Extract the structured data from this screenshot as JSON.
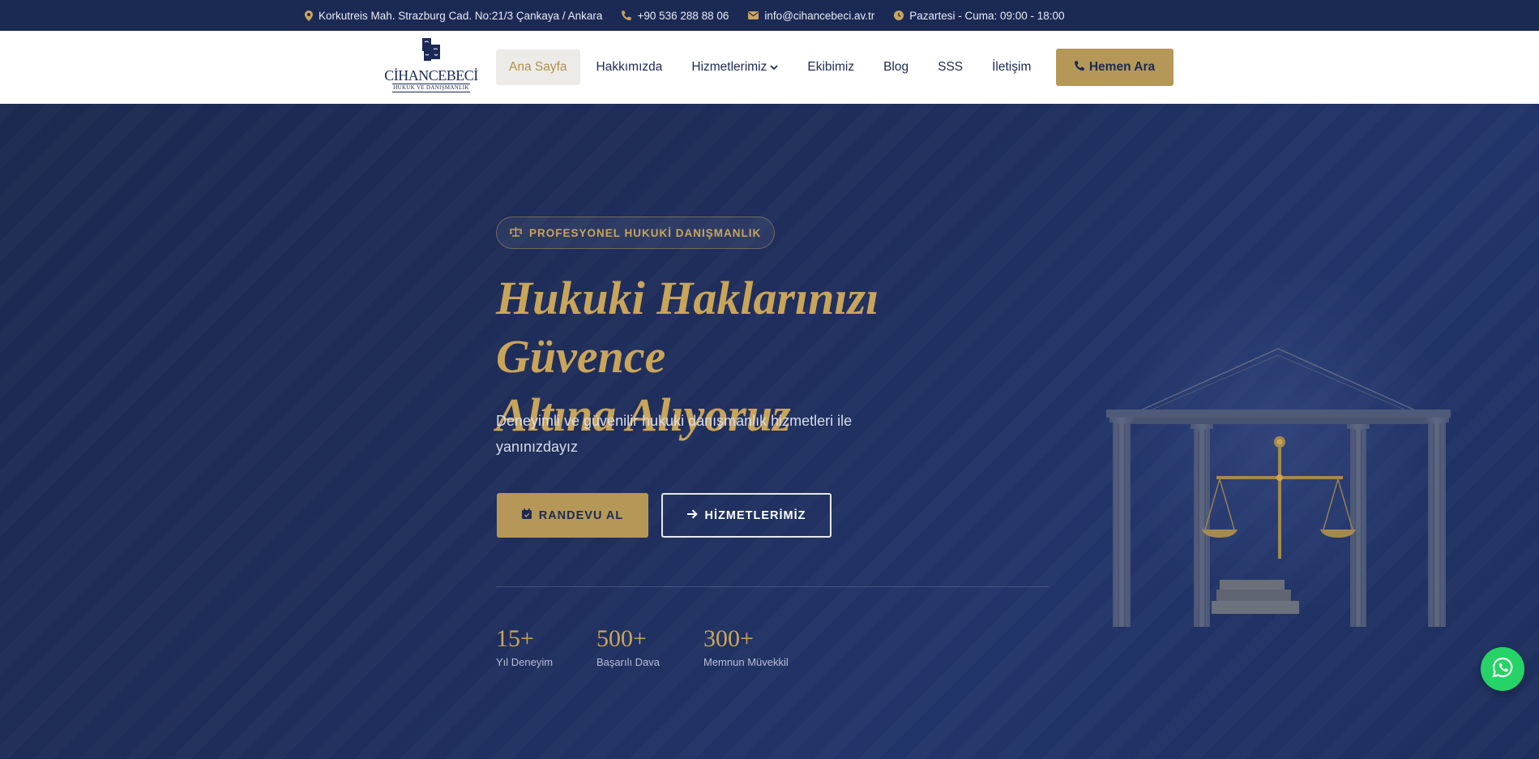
{
  "topbar": {
    "address": "Korkutreis Mah. Strazburg Cad. No:21/3 Çankaya / Ankara",
    "phone": "+90 536 288 88 06",
    "email": "info@cihancebeci.av.tr",
    "hours": "Pazartesi - Cuma: 09:00 - 18:00"
  },
  "logo": {
    "name": "CİHANCEBECİ",
    "tagline": "HUKUK VE DANIŞMANLIK"
  },
  "nav": {
    "items": [
      {
        "label": "Ana Sayfa",
        "active": true
      },
      {
        "label": "Hakkımızda"
      },
      {
        "label": "Hizmetlerimiz",
        "dropdown": true
      },
      {
        "label": "Ekibimiz"
      },
      {
        "label": "Blog"
      },
      {
        "label": "SSS"
      },
      {
        "label": "İletişim"
      }
    ],
    "call_label": "Hemen Ara"
  },
  "hero": {
    "badge": "PROFESYONEL HUKUKİ DANIŞMANLIK",
    "headline_line1": "Hukuki Haklarınızı Güvence",
    "headline_line2": "Altına Alıyoruz",
    "subtitle": "Deneyimli ve güvenilir hukuki danışmanlık hizmetleri ile yanınızdayız",
    "primary_button": "RANDEVU AL",
    "secondary_button": "HİZMETLERİMİZ",
    "stats": [
      {
        "value": "15+",
        "label": "Yıl Deneyim"
      },
      {
        "value": "500+",
        "label": "Başarılı Dava"
      },
      {
        "value": "300+",
        "label": "Memnun Müvekkil"
      }
    ]
  },
  "colors": {
    "navy": "#1b2a55",
    "gold": "#c9a55a",
    "button_gold": "#b59858",
    "whatsapp": "#25d366"
  },
  "icons": [
    "map-marker-icon",
    "phone-icon",
    "envelope-icon",
    "clock-icon",
    "chevron-down-icon",
    "scale-icon",
    "calendar-icon",
    "arrow-right-icon",
    "whatsapp-icon"
  ]
}
